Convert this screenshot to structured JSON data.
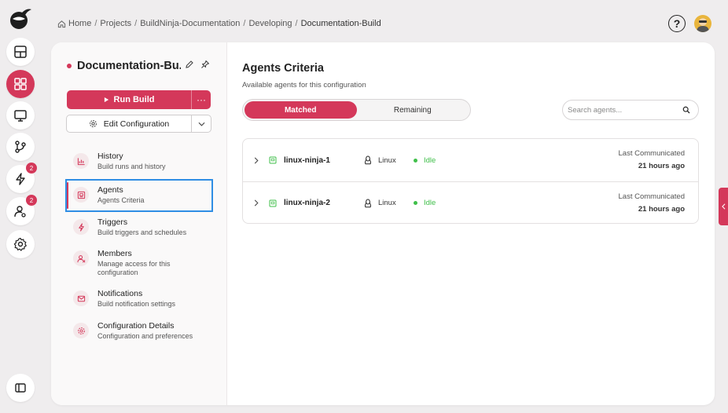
{
  "breadcrumb": {
    "items": [
      "Home",
      "Projects",
      "BuildNinja-Documentation",
      "Developing",
      "Documentation-Build"
    ],
    "separator": "/"
  },
  "header": {
    "help_label": "?"
  },
  "rail": {
    "badges": {
      "events": "2",
      "users": "2"
    }
  },
  "sidebar": {
    "config_name": "Documentation-Bu...",
    "run_build_label": "Run Build",
    "run_more_label": "···",
    "edit_config_label": "Edit Configuration",
    "items": [
      {
        "title": "History",
        "sub": "Build runs and history"
      },
      {
        "title": "Agents",
        "sub": "Agents Criteria"
      },
      {
        "title": "Triggers",
        "sub": "Build triggers and schedules"
      },
      {
        "title": "Members",
        "sub": "Manage access for this configuration"
      },
      {
        "title": "Notifications",
        "sub": "Build notification settings"
      },
      {
        "title": "Configuration Details",
        "sub": "Configuration and preferences"
      }
    ]
  },
  "main": {
    "title": "Agents Criteria",
    "subtitle": "Available agents for this configuration",
    "tabs": [
      "Matched",
      "Remaining"
    ],
    "search_placeholder": "Search agents...",
    "agents": [
      {
        "name": "linux-ninja-1",
        "os": "Linux",
        "status": "Idle",
        "lc_label": "Last Communicated",
        "lc_value": "21 hours ago"
      },
      {
        "name": "linux-ninja-2",
        "os": "Linux",
        "status": "Idle",
        "lc_label": "Last Communicated",
        "lc_value": "21 hours ago"
      }
    ]
  },
  "colors": {
    "accent": "#d4385a",
    "status_idle": "#3fbf4a",
    "focus": "#2f8ee4"
  }
}
